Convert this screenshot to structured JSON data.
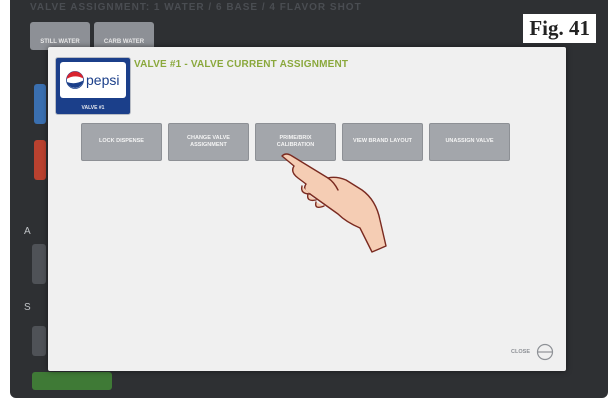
{
  "background": {
    "header": "VALVE ASSIGNMENT: 1 WATER / 6 BASE / 4 FLAVOR SHOT",
    "tabs": [
      "STILL WATER",
      "CARB WATER"
    ],
    "side_letters": [
      "A",
      "S"
    ]
  },
  "figure_label": "Fig. 41",
  "modal": {
    "brand_name": "pepsi",
    "valve_tag": "VALVE #1",
    "title": "VALVE #1 - VALVE CURRENT ASSIGNMENT",
    "buttons": [
      {
        "label": "LOCK DISPENSE"
      },
      {
        "label": "CHANGE VALVE ASSIGNMENT"
      },
      {
        "label": "PRIME/BRIX CALIBRATION"
      },
      {
        "label": "VIEW BRAND LAYOUT"
      },
      {
        "label": "UNASSIGN VALVE"
      }
    ],
    "close_label": "CLOSE"
  },
  "colors": {
    "title_green": "#8aa83c",
    "pepsi_blue": "#1b3f8a",
    "button_gray": "#a3a6ab"
  }
}
